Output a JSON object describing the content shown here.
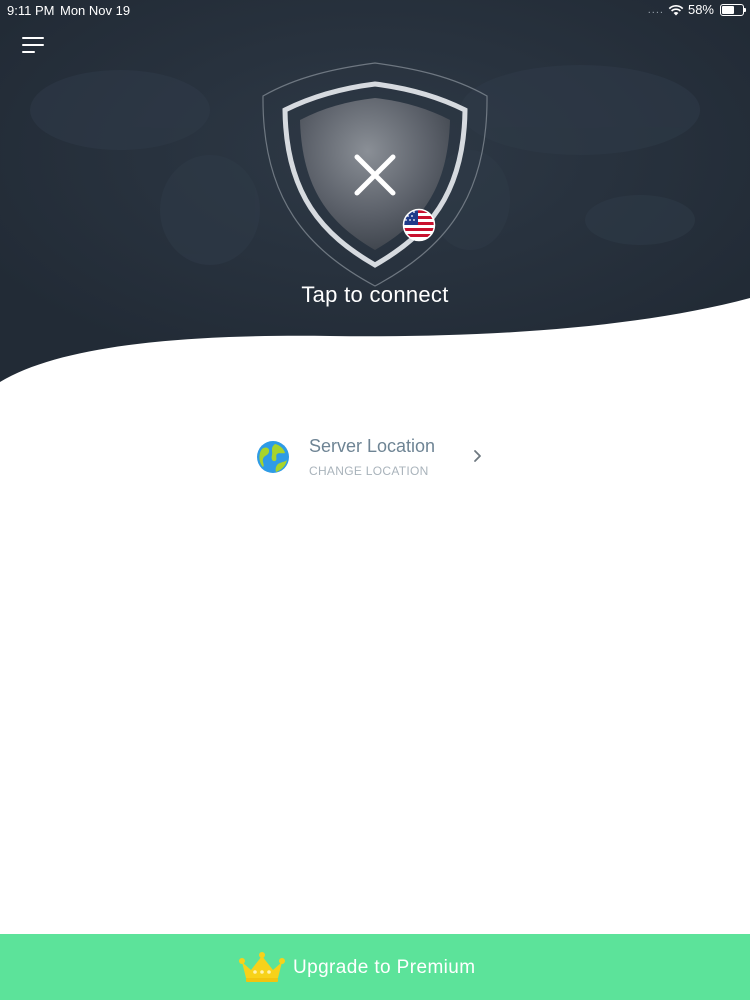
{
  "status_bar": {
    "time": "9:11 PM",
    "date": "Mon Nov 19",
    "signal": "....",
    "battery": "58%",
    "battery_level": 0.58
  },
  "header": {
    "menu_icon": "menu-icon"
  },
  "connect": {
    "state_icon": "close-icon",
    "flag_icon": "us-flag-icon",
    "label": "Tap to connect"
  },
  "server": {
    "icon": "globe-icon",
    "title": "Server Location",
    "subtitle": "CHANGE LOCATION",
    "chevron": "chevron-right-icon"
  },
  "upgrade": {
    "icon": "crown-icon",
    "label": "Upgrade to Premium"
  },
  "colors": {
    "hero_background": "#252f3b",
    "accent_green": "#5ce39a",
    "crown_yellow": "#f7d21a",
    "server_title": "#6e8494"
  }
}
